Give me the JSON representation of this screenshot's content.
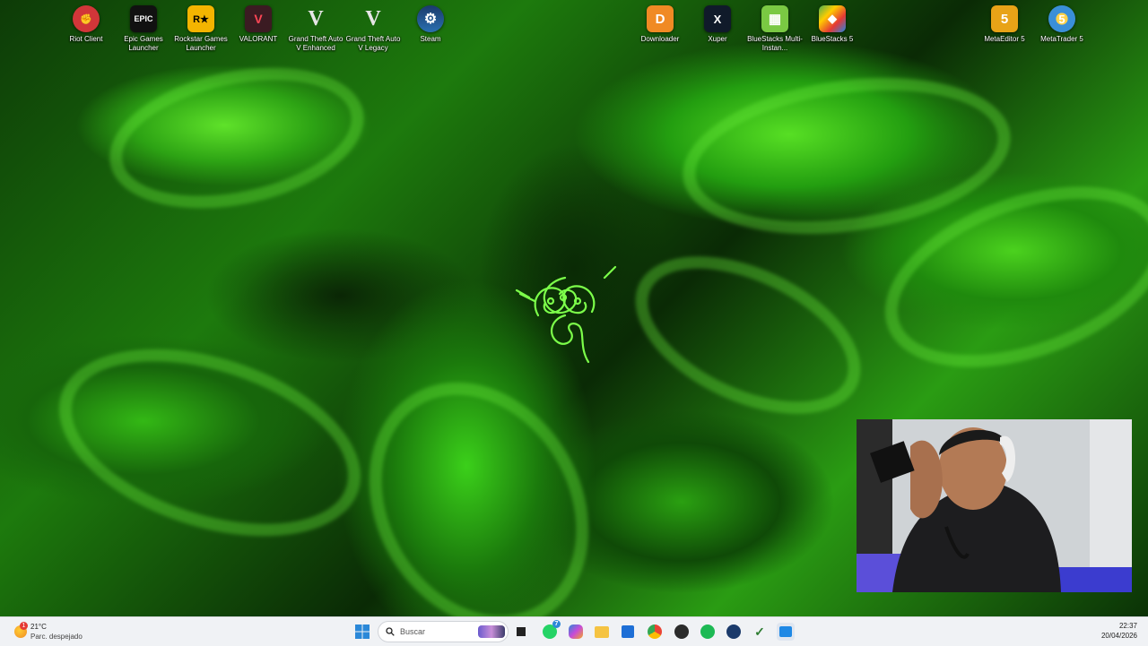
{
  "desktop": {
    "left_icons": [
      {
        "label": "Riot Client",
        "icon": "riot-fist-icon",
        "color": "#d13639",
        "glyph": "✊"
      },
      {
        "label": "Epic Games Launcher",
        "icon": "epic-games-icon",
        "color": "#111111",
        "glyph": "EPIC"
      },
      {
        "label": "Rockstar Games Launcher",
        "icon": "rockstar-icon",
        "color": "#f4b400",
        "glyph": "R★"
      },
      {
        "label": "VALORANT",
        "icon": "valorant-icon",
        "color": "#3b1b22",
        "glyph": "V"
      },
      {
        "label": "Grand Theft Auto V Enhanced",
        "icon": "gta-v-icon",
        "color": "transparent",
        "glyph": "V"
      },
      {
        "label": "Grand Theft Auto V Legacy",
        "icon": "gta-v-icon",
        "color": "transparent",
        "glyph": "V"
      },
      {
        "label": "Steam",
        "icon": "steam-icon",
        "color": "#1b3a6b",
        "glyph": "⚙"
      }
    ],
    "right_icons": [
      {
        "label": "Downloader",
        "icon": "downloader-icon",
        "color": "#f08a24",
        "glyph": "D"
      },
      {
        "label": "Xuper",
        "icon": "xuper-icon",
        "color": "#101a2a",
        "glyph": "X"
      },
      {
        "label": "BlueStacks Multi-Instan...",
        "icon": "bluestacks-multi-icon",
        "color": "#7ac943",
        "glyph": "▦"
      },
      {
        "label": "BlueStacks 5",
        "icon": "bluestacks-icon",
        "color": "#4caf50",
        "glyph": "◆"
      },
      {
        "label": "MetaEditor 5",
        "icon": "metaeditor-icon",
        "color": "#e8a317",
        "glyph": "5"
      },
      {
        "label": "MetaTrader 5",
        "icon": "metatrader-icon",
        "color": "#3a8fd8",
        "glyph": "5"
      }
    ]
  },
  "taskbar": {
    "weather": {
      "temp": "21°C",
      "desc": "Parc. despejado",
      "badge": "1"
    },
    "search_placeholder": "Buscar",
    "clock": {
      "time": "22:37",
      "date": "20/04/2026"
    },
    "whatsapp_badge": "7"
  },
  "colors": {
    "accent_green": "#44d62c",
    "taskbar_bg": "#f0f2f5"
  }
}
